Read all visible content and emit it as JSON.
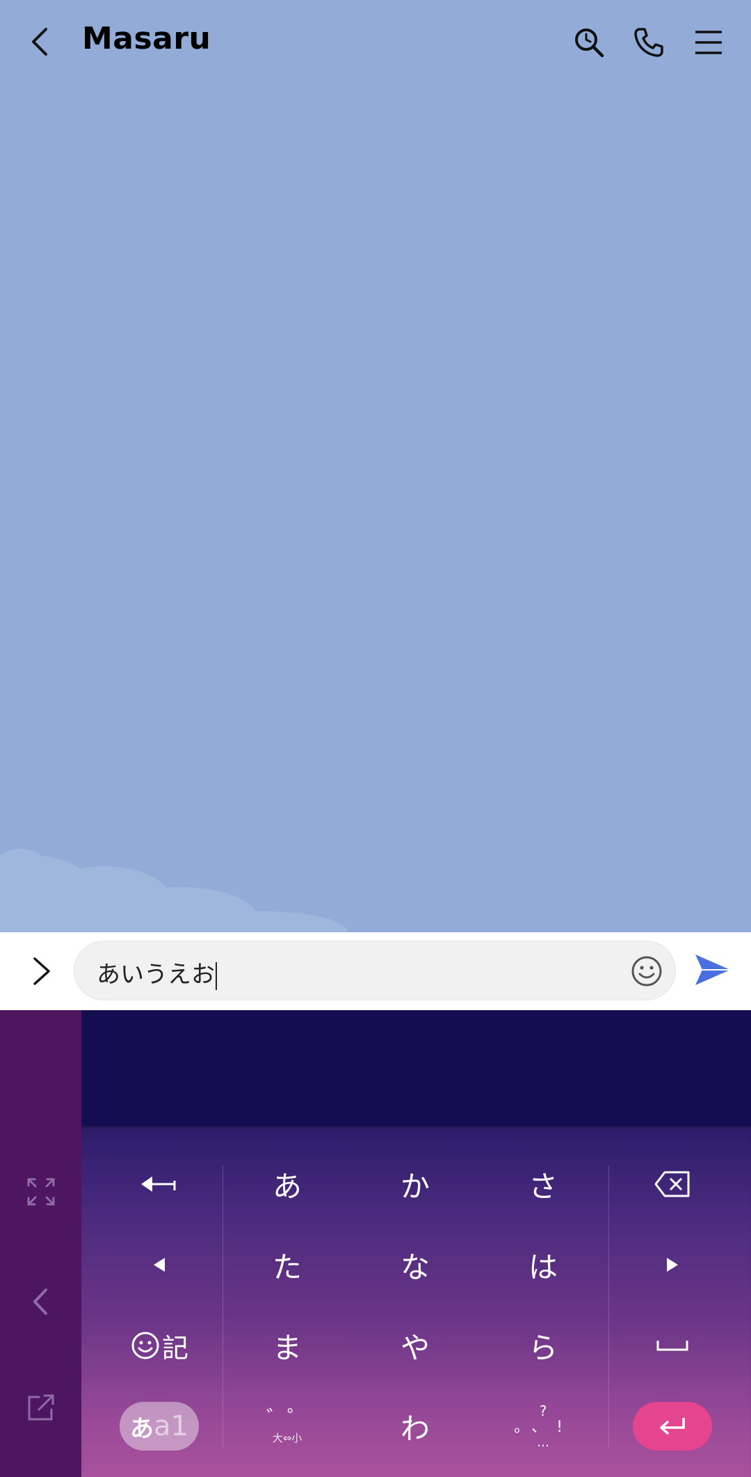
{
  "header": {
    "title": "Masaru"
  },
  "input": {
    "value": "あいうえお"
  },
  "keyboard": {
    "rows": [
      [
        "あ",
        "か",
        "さ"
      ],
      [
        "た",
        "な",
        "は"
      ],
      [
        "ま",
        "や",
        "ら"
      ]
    ],
    "kigou_label": "記",
    "mode_label_kana": "あ",
    "mode_label_alnum": "a1",
    "wa": "わ",
    "dakuten_top": "゛゜",
    "dakuten_bottom": "大⇔小",
    "punct_top": "?",
    "punct_middle": "。、!",
    "punct_bottom": "…"
  },
  "colors": {
    "chat_bg": "#93acd7",
    "keyboard_candidates": "#140d52",
    "keyboard_side": "#4e1560",
    "enter_key": "#e5458f",
    "send_icon": "#4a6fe0"
  }
}
